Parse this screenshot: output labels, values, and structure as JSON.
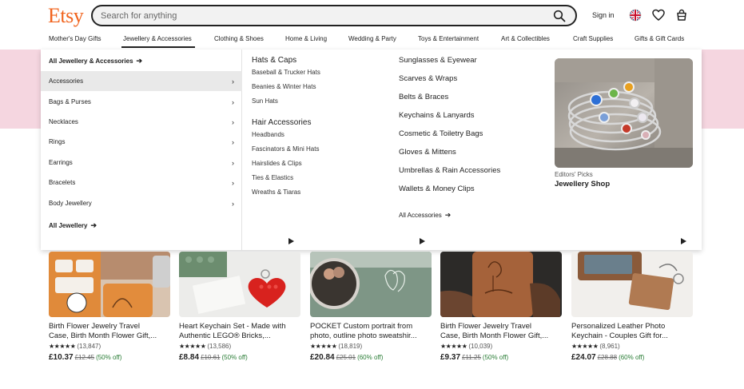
{
  "header": {
    "logo": "Etsy",
    "search_placeholder": "Search for anything",
    "signin": "Sign in"
  },
  "nav": [
    "Mother's Day Gifts",
    "Jewellery & Accessories",
    "Clothing & Shoes",
    "Home & Living",
    "Wedding & Party",
    "Toys & Entertainment",
    "Art & Collectibles",
    "Craft Supplies",
    "Gifts & Gift Cards"
  ],
  "mega": {
    "all_top": "All Jewellery & Accessories",
    "left_items": [
      "Accessories",
      "Bags & Purses",
      "Necklaces",
      "Rings",
      "Earrings",
      "Bracelets",
      "Body Jewellery"
    ],
    "all_bottom": "All Jewellery",
    "col2": {
      "h1": "Hats & Caps",
      "h1_items": [
        "Baseball & Trucker Hats",
        "Beanies & Winter Hats",
        "Sun Hats"
      ],
      "h2": "Hair Accessories",
      "h2_items": [
        "Headbands",
        "Fascinators & Mini Hats",
        "Hairslides & Clips",
        "Ties & Elastics",
        "Wreaths & Tiaras"
      ]
    },
    "col3": {
      "items": [
        "Sunglasses & Eyewear",
        "Scarves & Wraps",
        "Belts & Braces",
        "Keychains & Lanyards",
        "Cosmetic & Toiletry Bags",
        "Gloves & Mittens",
        "Umbrellas & Rain Accessories",
        "Wallets & Money Clips"
      ],
      "all": "All Accessories"
    },
    "feature": {
      "sub": "Editors' Picks",
      "title": "Jewellery Shop"
    }
  },
  "products": [
    {
      "l1": "Birth Flower Jewelry Travel",
      "l2": "Case, Birth Month Flower Gift,...",
      "stars": "★★★★★",
      "count": "(13,847)",
      "price": "£10.37",
      "was": "£12.45",
      "off": "(50% off)",
      "play": false
    },
    {
      "l1": "Heart Keychain Set - Made with",
      "l2": "Authentic LEGO® Bricks,...",
      "stars": "★★★★★",
      "count": "(13,586)",
      "price": "£8.84",
      "was": "£10.61",
      "off": "(50% off)",
      "play": true
    },
    {
      "l1": "POCKET Custom portrait from",
      "l2": "photo, outline photo sweatshir...",
      "stars": "★★★★★",
      "count": "(18,819)",
      "price": "£20.84",
      "was": "£25.01",
      "off": "(60% off)",
      "play": true
    },
    {
      "l1": "Birth Flower Jewelry Travel",
      "l2": "Case, Birth Month Flower Gift,...",
      "stars": "★★★★★",
      "count": "(10,039)",
      "price": "£9.37",
      "was": "£11.25",
      "off": "(50% off)",
      "play": false
    },
    {
      "l1": "Personalized Leather Photo",
      "l2": "Keychain - Couples Gift for...",
      "stars": "★★★★★",
      "count": "(8,961)",
      "price": "£24.07",
      "was": "£28.88",
      "off": "(60% off)",
      "play": true
    }
  ]
}
